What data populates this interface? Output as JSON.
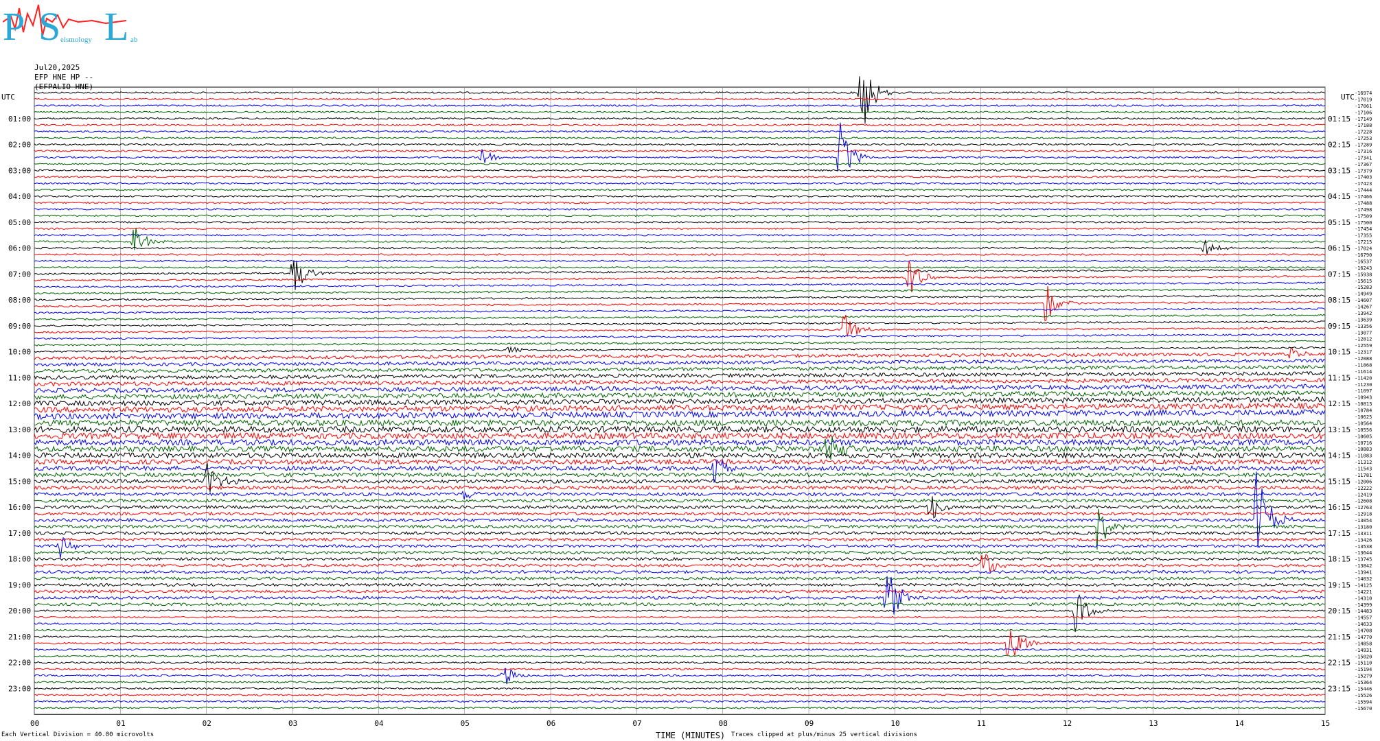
{
  "logo": {
    "letters": [
      "P",
      "S",
      "L"
    ],
    "small_text": [
      "eismology",
      "ab"
    ],
    "colors": {
      "letters": "#2aa9d6",
      "trace": "#ff2020"
    }
  },
  "header": {
    "date": "Jul20,2025",
    "station": "EFP HNE HP --",
    "channel": "(EFPALIO-HNE)"
  },
  "left_axis_label": "UTC",
  "right_axis_label": "UTC",
  "footer": {
    "scale_note": "Each Vertical Division =   40.00 microvolts",
    "xlabel": "TIME (MINUTES)",
    "clip_note": "Traces clipped at plus/minus 25 vertical divisions"
  },
  "chart_data": {
    "type": "line",
    "subtype": "helicorder",
    "x": [
      0,
      15
    ],
    "xlim": [
      0,
      15
    ],
    "x_tick_labels": [
      "00",
      "01",
      "02",
      "03",
      "04",
      "05",
      "06",
      "07",
      "08",
      "09",
      "10",
      "11",
      "12",
      "13",
      "14",
      "15"
    ],
    "grid": "vertical",
    "trace_colors": [
      "#000000",
      "#ff0000",
      "#0000ff",
      "#006400"
    ],
    "traces_per_hour": 4,
    "num_traces": 96,
    "left_hour_labels": [
      "01:00",
      "02:00",
      "03:00",
      "04:00",
      "05:00",
      "06:00",
      "07:00",
      "08:00",
      "09:00",
      "10:00",
      "11:00",
      "12:00",
      "13:00",
      "14:00",
      "15:00",
      "16:00",
      "17:00",
      "18:00",
      "19:00",
      "20:00",
      "21:00",
      "22:00",
      "23:00"
    ],
    "right_hour_labels": [
      "01:15",
      "02:15",
      "03:15",
      "04:15",
      "05:15",
      "06:15",
      "07:15",
      "08:15",
      "09:15",
      "10:15",
      "11:15",
      "12:15",
      "13:15",
      "14:15",
      "15:15",
      "16:15",
      "17:15",
      "18:15",
      "19:15",
      "20:15",
      "21:15",
      "22:15",
      "23:15"
    ],
    "trace_offsets": [
      -16974,
      -17019,
      -17061,
      -17106,
      -17149,
      -17188,
      -17228,
      -17253,
      -17289,
      -17316,
      -17341,
      -17367,
      -17379,
      -17403,
      -17423,
      -17444,
      -17466,
      -17488,
      -17498,
      -17509,
      -17500,
      -17454,
      -17355,
      -17215,
      -17024,
      -16790,
      -16537,
      -16243,
      -15938,
      -15615,
      -15283,
      -14949,
      -14607,
      -14267,
      -13942,
      -13639,
      -13356,
      -13077,
      -12812,
      -12559,
      -12317,
      -12088,
      -11868,
      -11614,
      -11420,
      -11230,
      -11097,
      -10943,
      -10813,
      -10784,
      -10625,
      -10564,
      -10556,
      -10605,
      -10716,
      -10883,
      -11083,
      -11312,
      -11543,
      -11781,
      -12006,
      -12222,
      -12419,
      -12608,
      -12763,
      -12918,
      -13054,
      -13180,
      -13311,
      -13426,
      -13538,
      -13644,
      -13745,
      -13842,
      -13941,
      -14032,
      -14125,
      -14221,
      -14310,
      -14399,
      -14483,
      -14557,
      -14633,
      -14708,
      -14770,
      -14858,
      -14931,
      -15020,
      -15110,
      -15194,
      -15279,
      -15364,
      -15446,
      -15526,
      -15594,
      -15670
    ],
    "events": [
      {
        "trace": 0,
        "minute": 9.6,
        "amp": 80
      },
      {
        "trace": 10,
        "minute": 9.35,
        "amp": 60
      },
      {
        "trace": 10,
        "minute": 5.2,
        "amp": 20
      },
      {
        "trace": 23,
        "minute": 1.15,
        "amp": 28
      },
      {
        "trace": 24,
        "minute": 13.6,
        "amp": 15
      },
      {
        "trace": 28,
        "minute": 3.0,
        "amp": 40
      },
      {
        "trace": 29,
        "minute": 10.15,
        "amp": 40
      },
      {
        "trace": 33,
        "minute": 11.75,
        "amp": 35
      },
      {
        "trace": 37,
        "minute": 9.4,
        "amp": 30
      },
      {
        "trace": 40,
        "minute": 5.5,
        "amp": 10
      },
      {
        "trace": 41,
        "minute": 14.6,
        "amp": 10
      },
      {
        "trace": 55,
        "minute": 9.2,
        "amp": 40
      },
      {
        "trace": 58,
        "minute": 7.9,
        "amp": 25
      },
      {
        "trace": 60,
        "minute": 2.0,
        "amp": 40
      },
      {
        "trace": 62,
        "minute": 5.0,
        "amp": 10
      },
      {
        "trace": 64,
        "minute": 10.4,
        "amp": 30
      },
      {
        "trace": 66,
        "minute": 14.2,
        "amp": 90
      },
      {
        "trace": 67,
        "minute": 12.35,
        "amp": 40
      },
      {
        "trace": 70,
        "minute": 0.3,
        "amp": 20
      },
      {
        "trace": 73,
        "minute": 11.0,
        "amp": 30
      },
      {
        "trace": 78,
        "minute": 9.9,
        "amp": 60
      },
      {
        "trace": 80,
        "minute": 12.1,
        "amp": 35
      },
      {
        "trace": 85,
        "minute": 11.3,
        "amp": 55
      },
      {
        "trace": 90,
        "minute": 5.45,
        "amp": 20
      }
    ]
  }
}
